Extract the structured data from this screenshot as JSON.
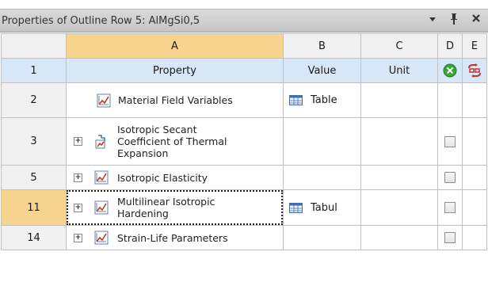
{
  "panel": {
    "title": "Properties of Outline Row 5: AlMgSi0,5",
    "controls": {
      "dropdown": "▾",
      "pin": "ᵖ",
      "close": "x"
    }
  },
  "columns": [
    "A",
    "B",
    "C",
    "D",
    "E"
  ],
  "header_row": {
    "number": "1",
    "property": "Property",
    "value": "Value",
    "unit": "Unit",
    "d_icon": "green-circle-x-icon",
    "e_icon": "red-link-arrows-icon"
  },
  "rows": [
    {
      "number": "2",
      "expandable": false,
      "icon": "table-chart-icon",
      "property": "Material Field Variables",
      "value": "Table",
      "value_icon": "table-icon",
      "checkbox": false,
      "selected": false
    },
    {
      "number": "3",
      "expandable": true,
      "expander": "+",
      "icon": "secant-coefficient-icon",
      "property": "Isotropic Secant Coefficient of Thermal Expansion",
      "value": "",
      "checkbox": true,
      "selected": false
    },
    {
      "number": "5",
      "expandable": true,
      "expander": "+",
      "icon": "chart-icon",
      "property": "Isotropic Elasticity",
      "value": "",
      "checkbox": true,
      "selected": false
    },
    {
      "number": "11",
      "expandable": true,
      "expander": "+",
      "icon": "chart-icon",
      "property": "Multilinear Isotropic Hardening",
      "value": "Tabul",
      "value_icon": "table-icon",
      "checkbox": true,
      "selected": true
    },
    {
      "number": "14",
      "expandable": true,
      "expander": "+",
      "icon": "chart-icon",
      "property": "Strain-Life Parameters",
      "value": "",
      "checkbox": true,
      "selected": false
    }
  ],
  "colors": {
    "selected_column": "#f6d48e",
    "header_row": "#d7e7f7",
    "border": "#c0c0c0"
  }
}
